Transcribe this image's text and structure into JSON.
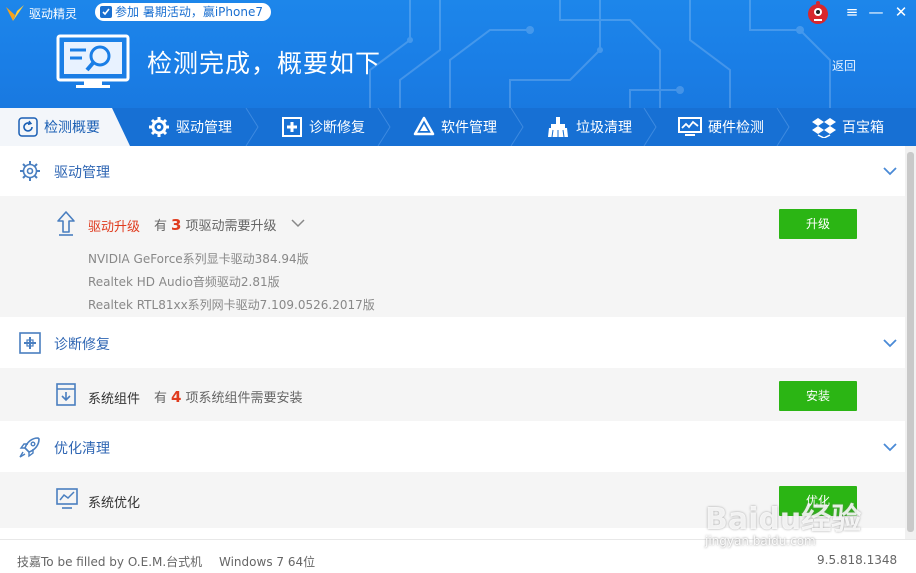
{
  "titlebar": {
    "app_name": "驱动精灵",
    "promo": "参加 暑期活动，赢iPhone7",
    "menu_icon": "≡",
    "min_icon": "—",
    "close_icon": "✕"
  },
  "header": {
    "title": "检测完成，概要如下",
    "back": "返回"
  },
  "tabs": [
    {
      "label": "检测概要",
      "icon": "refresh-icon",
      "active": true
    },
    {
      "label": "驱动管理",
      "icon": "gear-icon"
    },
    {
      "label": "诊断修复",
      "icon": "diagnose-icon"
    },
    {
      "label": "软件管理",
      "icon": "software-icon"
    },
    {
      "label": "垃圾清理",
      "icon": "broom-icon"
    },
    {
      "label": "硬件检测",
      "icon": "hardware-icon"
    },
    {
      "label": "百宝箱",
      "icon": "toolbox-icon"
    }
  ],
  "sections": {
    "driver": {
      "title": "驱动管理",
      "item_name": "驱动升级",
      "desc_prefix": "有",
      "count": "3",
      "desc_suffix": "项驱动需要升级",
      "button": "升级",
      "details": [
        "NVIDIA GeForce系列显卡驱动384.94版",
        "Realtek HD Audio音频驱动2.81版",
        "Realtek RTL81xx系列网卡驱动7.109.0526.2017版"
      ]
    },
    "diagnose": {
      "title": "诊断修复",
      "item_name": "系统组件",
      "desc_prefix": "有",
      "count": "4",
      "desc_suffix": "项系统组件需要安装",
      "button": "安装"
    },
    "optimize": {
      "title": "优化清理",
      "item_name": "系统优化",
      "button": "优化"
    }
  },
  "footer": {
    "machine": "技嘉To be filled by O.E.M.台式机",
    "os": "Windows 7 64位",
    "version": "9.5.818.1348"
  },
  "watermark": {
    "text": "Baidu经验",
    "url": "jingyan.baidu.com"
  },
  "colors": {
    "header_blue": "#1a7ee6",
    "tab_blue": "#1770d4",
    "accent_red": "#e03c1f",
    "button_green": "#2bb514",
    "section_blue": "#2f66b3"
  }
}
